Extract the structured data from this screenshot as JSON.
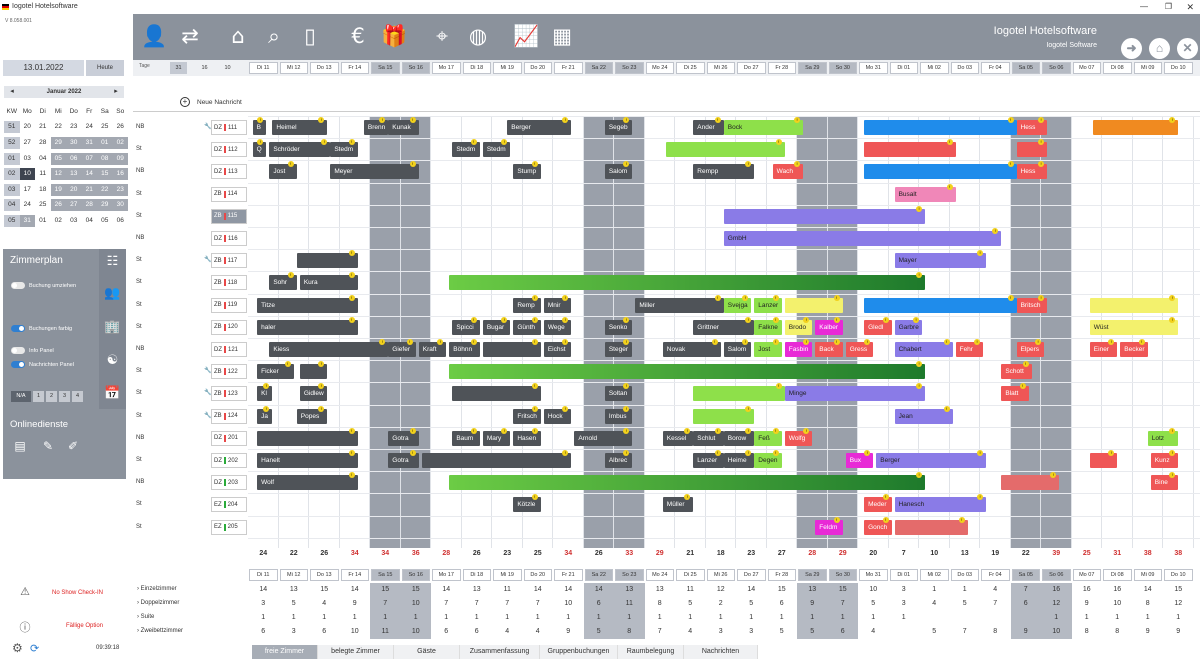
{
  "app": {
    "title": "Iogotel Hotelsoftware",
    "version": "V 8.058.001"
  },
  "calendar": {
    "date": "13.01.2022",
    "today_label": "Heute",
    "month_label": "Januar 2022",
    "prev": "◂",
    "next": "▸",
    "weekdays": [
      "KW",
      "Mo",
      "Di",
      "Mi",
      "Do",
      "Fr",
      "Sa",
      "So"
    ],
    "rows": [
      [
        "51",
        "20",
        "21",
        "22",
        "23",
        "24",
        "25",
        "26"
      ],
      [
        "52",
        "27",
        "28",
        "29",
        "30",
        "31",
        "01",
        "02"
      ],
      [
        "01",
        "03",
        "04",
        "05",
        "06",
        "07",
        "08",
        "09"
      ],
      [
        "02",
        "10",
        "11",
        "12",
        "13",
        "14",
        "15",
        "16"
      ],
      [
        "03",
        "17",
        "18",
        "19",
        "20",
        "21",
        "22",
        "23"
      ],
      [
        "04",
        "24",
        "25",
        "26",
        "27",
        "28",
        "29",
        "30"
      ],
      [
        "05",
        "31",
        "01",
        "02",
        "03",
        "04",
        "05",
        "06"
      ]
    ]
  },
  "sidepanel": {
    "title": "Zimmerplan",
    "toggles": [
      {
        "label": "Buchung umziehen",
        "on": false
      },
      {
        "label": "Buchungen farbig",
        "on": true
      },
      {
        "label": "Info Panel",
        "on": false
      },
      {
        "label": "Nachrichten Panel",
        "on": true
      }
    ],
    "pages": [
      "N/A",
      "1",
      "2",
      "3",
      "4"
    ],
    "online_title": "Onlinedienste"
  },
  "bottom_left": {
    "no_show": "No Show Check-IN",
    "faellige": "Fällige Option",
    "clock": "09:39:18"
  },
  "toolbar": {
    "brand": "Iogotel Hotelsoftware",
    "brand_sub": "Iogotel Software"
  },
  "date_strip": {
    "label": "Tage",
    "options": [
      "31",
      "16",
      "10"
    ]
  },
  "days": [
    "Di 11",
    "Mi 12",
    "Do 13",
    "Fr 14",
    "Sa 15",
    "So 16",
    "Mo 17",
    "Di 18",
    "Mi 19",
    "Do 20",
    "Fr 21",
    "Sa 22",
    "So 23",
    "Mo 24",
    "Di 25",
    "Mi 26",
    "Do 27",
    "Fr 28",
    "Sa 29",
    "So 30",
    "Mo 31",
    "Di 01",
    "Mi 02",
    "Do 03",
    "Fr 04",
    "Sa 05",
    "So 06",
    "Mo 07",
    "Di 08",
    "Mi 09",
    "Do 10"
  ],
  "weekend_idx": [
    4,
    5,
    11,
    12,
    18,
    19,
    25,
    26
  ],
  "new_message": "Neue Nachricht",
  "rooms": [
    {
      "cat": "NB",
      "type": "DZ",
      "no": "111",
      "wrench": true,
      "dot": "r"
    },
    {
      "cat": "St",
      "type": "DZ",
      "no": "112",
      "wrench": false,
      "dot": "r"
    },
    {
      "cat": "NB",
      "type": "DZ",
      "no": "113",
      "wrench": false,
      "dot": "r"
    },
    {
      "cat": "St",
      "type": "ZB",
      "no": "114",
      "wrench": false,
      "dot": "r"
    },
    {
      "cat": "St",
      "type": "ZB",
      "no": "115",
      "wrench": false,
      "dot": "r",
      "sel": true
    },
    {
      "cat": "NB",
      "type": "DZ",
      "no": "116",
      "wrench": false,
      "dot": "r"
    },
    {
      "cat": "St",
      "type": "ZB",
      "no": "117",
      "wrench": true,
      "dot": "r"
    },
    {
      "cat": "St",
      "type": "ZB",
      "no": "118",
      "wrench": false,
      "dot": "r"
    },
    {
      "cat": "St",
      "type": "ZB",
      "no": "119",
      "wrench": false,
      "dot": "r"
    },
    {
      "cat": "St",
      "type": "ZB",
      "no": "120",
      "wrench": false,
      "dot": "r"
    },
    {
      "cat": "NB",
      "type": "DZ",
      "no": "121",
      "wrench": false,
      "dot": "r"
    },
    {
      "cat": "St",
      "type": "ZB",
      "no": "122",
      "wrench": true,
      "dot": "r"
    },
    {
      "cat": "St",
      "type": "ZB",
      "no": "123",
      "wrench": true,
      "dot": "r"
    },
    {
      "cat": "St",
      "type": "ZB",
      "no": "124",
      "wrench": true,
      "dot": "r"
    },
    {
      "cat": "NB",
      "type": "DZ",
      "no": "201",
      "wrench": false,
      "dot": "r"
    },
    {
      "cat": "St",
      "type": "DZ",
      "no": "202",
      "wrench": false,
      "dot": "g"
    },
    {
      "cat": "NB",
      "type": "DZ",
      "no": "203",
      "wrench": false,
      "dot": "g"
    },
    {
      "cat": "St",
      "type": "EZ",
      "no": "204",
      "wrench": false,
      "dot": "g"
    },
    {
      "cat": "St",
      "type": "EZ",
      "no": "205",
      "wrench": false,
      "dot": "g"
    }
  ],
  "bookings": [
    {
      "row": 0,
      "s": 0.15,
      "e": 0.6,
      "c": "dark",
      "t": "B"
    },
    {
      "row": 0,
      "s": 0.8,
      "e": 2.6,
      "c": "dark",
      "t": "Heimel"
    },
    {
      "row": 0,
      "s": 3.8,
      "e": 4.6,
      "c": "dark",
      "t": "Brenn"
    },
    {
      "row": 0,
      "s": 4.6,
      "e": 5.6,
      "c": "dark",
      "t": "Kunak"
    },
    {
      "row": 0,
      "s": 8.5,
      "e": 10.6,
      "c": "dark",
      "t": "Berger"
    },
    {
      "row": 0,
      "s": 11.7,
      "e": 12.6,
      "c": "dark",
      "t": "Segeb"
    },
    {
      "row": 0,
      "s": 14.6,
      "e": 15.6,
      "c": "dark",
      "t": "Ander"
    },
    {
      "row": 0,
      "s": 15.6,
      "e": 18.2,
      "c": "lime",
      "t": "Bock"
    },
    {
      "row": 0,
      "s": 20.2,
      "e": 25.2,
      "c": "blue",
      "t": ""
    },
    {
      "row": 0,
      "s": 25.2,
      "e": 26.2,
      "c": "red",
      "t": "Hess"
    },
    {
      "row": 0,
      "s": 27.7,
      "e": 30.5,
      "c": "orange",
      "t": ""
    },
    {
      "row": 1,
      "s": 0.15,
      "e": 0.6,
      "c": "dark",
      "t": "Q"
    },
    {
      "row": 1,
      "s": 0.7,
      "e": 2.7,
      "c": "dark",
      "t": "Schröder"
    },
    {
      "row": 1,
      "s": 2.7,
      "e": 3.6,
      "c": "dark",
      "t": "Stedm"
    },
    {
      "row": 1,
      "s": 6.7,
      "e": 7.6,
      "c": "dark",
      "t": "Stedm"
    },
    {
      "row": 1,
      "s": 7.7,
      "e": 8.6,
      "c": "dark",
      "t": "Stedm"
    },
    {
      "row": 1,
      "s": 13.7,
      "e": 17.6,
      "c": "lime",
      "t": ""
    },
    {
      "row": 1,
      "s": 20.2,
      "e": 23.2,
      "c": "red",
      "t": ""
    },
    {
      "row": 1,
      "s": 25.2,
      "e": 26.2,
      "c": "red",
      "t": ""
    },
    {
      "row": 2,
      "s": 0.7,
      "e": 1.6,
      "c": "dark",
      "t": "Jost"
    },
    {
      "row": 2,
      "s": 2.7,
      "e": 5.6,
      "c": "dark",
      "t": "Meyer"
    },
    {
      "row": 2,
      "s": 8.7,
      "e": 9.6,
      "c": "dark",
      "t": "Stump"
    },
    {
      "row": 2,
      "s": 11.7,
      "e": 12.6,
      "c": "dark",
      "t": "Salom"
    },
    {
      "row": 2,
      "s": 14.6,
      "e": 16.6,
      "c": "dark",
      "t": "Rempp"
    },
    {
      "row": 2,
      "s": 17.2,
      "e": 18.2,
      "c": "red",
      "t": "Wach"
    },
    {
      "row": 2,
      "s": 20.2,
      "e": 25.2,
      "c": "blue",
      "t": ""
    },
    {
      "row": 2,
      "s": 25.2,
      "e": 26.2,
      "c": "red",
      "t": "Hess"
    },
    {
      "row": 3,
      "s": 21.2,
      "e": 23.2,
      "c": "pink",
      "t": "Busalt"
    },
    {
      "row": 4,
      "s": 15.6,
      "e": 22.2,
      "c": "purple",
      "t": ""
    },
    {
      "row": 5,
      "s": 15.6,
      "e": 24.7,
      "c": "purple",
      "t": "GmbH"
    },
    {
      "row": 6,
      "s": 1.6,
      "e": 3.6,
      "c": "dark",
      "t": ""
    },
    {
      "row": 6,
      "s": 21.2,
      "e": 24.2,
      "c": "purple",
      "t": "Mayer"
    },
    {
      "row": 7,
      "s": 0.7,
      "e": 1.6,
      "c": "dark",
      "t": "Sohr"
    },
    {
      "row": 7,
      "s": 1.7,
      "e": 3.6,
      "c": "dark",
      "t": "Kura"
    },
    {
      "row": 7,
      "s": 6.6,
      "e": 22.2,
      "c": "green",
      "t": ""
    },
    {
      "row": 8,
      "s": 0.3,
      "e": 3.6,
      "c": "dark",
      "t": "Titze"
    },
    {
      "row": 8,
      "s": 8.7,
      "e": 9.6,
      "c": "dark",
      "t": "Remp"
    },
    {
      "row": 8,
      "s": 9.7,
      "e": 10.6,
      "c": "dark",
      "t": "Mnir"
    },
    {
      "row": 8,
      "s": 12.7,
      "e": 15.6,
      "c": "dark",
      "t": "Miller"
    },
    {
      "row": 8,
      "s": 15.6,
      "e": 16.5,
      "c": "lime",
      "t": "Svejga"
    },
    {
      "row": 8,
      "s": 16.6,
      "e": 17.5,
      "c": "lime",
      "t": "Lanzer"
    },
    {
      "row": 8,
      "s": 17.6,
      "e": 19.5,
      "c": "yellow",
      "t": ""
    },
    {
      "row": 8,
      "s": 20.2,
      "e": 25.2,
      "c": "blue",
      "t": ""
    },
    {
      "row": 8,
      "s": 25.2,
      "e": 26.2,
      "c": "red",
      "t": "Britsch"
    },
    {
      "row": 8,
      "s": 27.6,
      "e": 30.5,
      "c": "yellow",
      "t": ""
    },
    {
      "row": 9,
      "s": 0.3,
      "e": 3.6,
      "c": "dark",
      "t": "haler"
    },
    {
      "row": 9,
      "s": 6.7,
      "e": 7.6,
      "c": "dark",
      "t": "Spicci"
    },
    {
      "row": 9,
      "s": 7.7,
      "e": 8.6,
      "c": "dark",
      "t": "Bugar"
    },
    {
      "row": 9,
      "s": 8.7,
      "e": 9.6,
      "c": "dark",
      "t": "Günth"
    },
    {
      "row": 9,
      "s": 9.7,
      "e": 10.6,
      "c": "dark",
      "t": "Wege"
    },
    {
      "row": 9,
      "s": 11.7,
      "e": 12.6,
      "c": "dark",
      "t": "Senko"
    },
    {
      "row": 9,
      "s": 14.6,
      "e": 16.6,
      "c": "dark",
      "t": "Grittner"
    },
    {
      "row": 9,
      "s": 16.6,
      "e": 17.5,
      "c": "lime",
      "t": "Falkne"
    },
    {
      "row": 9,
      "s": 17.6,
      "e": 18.5,
      "c": "yellow",
      "t": "Brodo"
    },
    {
      "row": 9,
      "s": 18.6,
      "e": 19.5,
      "c": "magenta",
      "t": "Kalber"
    },
    {
      "row": 9,
      "s": 20.2,
      "e": 21.1,
      "c": "red",
      "t": "Gledl"
    },
    {
      "row": 9,
      "s": 21.2,
      "e": 22.1,
      "c": "purple",
      "t": "Garbre"
    },
    {
      "row": 9,
      "s": 27.6,
      "e": 30.5,
      "c": "yellow",
      "t": "Wüst"
    },
    {
      "row": 10,
      "s": 0.7,
      "e": 4.6,
      "c": "dark",
      "t": "Kiess"
    },
    {
      "row": 10,
      "s": 4.6,
      "e": 5.5,
      "c": "dark",
      "t": "Giefer"
    },
    {
      "row": 10,
      "s": 5.6,
      "e": 6.5,
      "c": "dark",
      "t": "Kraft"
    },
    {
      "row": 10,
      "s": 6.6,
      "e": 7.6,
      "c": "dark",
      "t": "Böhnn"
    },
    {
      "row": 10,
      "s": 7.7,
      "e": 9.6,
      "c": "dark",
      "t": ""
    },
    {
      "row": 10,
      "s": 9.7,
      "e": 10.6,
      "c": "dark",
      "t": "Eichst"
    },
    {
      "row": 10,
      "s": 11.7,
      "e": 12.6,
      "c": "dark",
      "t": "Steger"
    },
    {
      "row": 10,
      "s": 13.6,
      "e": 15.5,
      "c": "dark",
      "t": "Novak"
    },
    {
      "row": 10,
      "s": 15.6,
      "e": 16.5,
      "c": "dark",
      "t": "Salom"
    },
    {
      "row": 10,
      "s": 16.6,
      "e": 17.5,
      "c": "lime",
      "t": "Jost"
    },
    {
      "row": 10,
      "s": 17.6,
      "e": 18.5,
      "c": "magenta",
      "t": "Fasbin"
    },
    {
      "row": 10,
      "s": 18.6,
      "e": 19.5,
      "c": "red",
      "t": "Back"
    },
    {
      "row": 10,
      "s": 19.6,
      "e": 20.5,
      "c": "red",
      "t": "Gress"
    },
    {
      "row": 10,
      "s": 21.2,
      "e": 23.1,
      "c": "purple",
      "t": "Chabert"
    },
    {
      "row": 10,
      "s": 23.2,
      "e": 24.1,
      "c": "red",
      "t": "Fehr"
    },
    {
      "row": 10,
      "s": 25.2,
      "e": 26.1,
      "c": "red",
      "t": "Elpers"
    },
    {
      "row": 10,
      "s": 27.6,
      "e": 28.5,
      "c": "red",
      "t": "Einer"
    },
    {
      "row": 10,
      "s": 28.6,
      "e": 29.5,
      "c": "red",
      "t": "Becker"
    },
    {
      "row": 11,
      "s": 0.3,
      "e": 1.5,
      "c": "dark",
      "t": "Ficker"
    },
    {
      "row": 11,
      "s": 1.7,
      "e": 2.6,
      "c": "dark",
      "t": ""
    },
    {
      "row": 11,
      "s": 6.6,
      "e": 22.2,
      "c": "green",
      "t": ""
    },
    {
      "row": 11,
      "s": 24.7,
      "e": 25.7,
      "c": "red",
      "t": "Schott"
    },
    {
      "row": 12,
      "s": 0.3,
      "e": 0.8,
      "c": "dark",
      "t": "Kl"
    },
    {
      "row": 12,
      "s": 1.7,
      "e": 2.6,
      "c": "dark",
      "t": "Gidlew"
    },
    {
      "row": 12,
      "s": 6.7,
      "e": 9.6,
      "c": "dark",
      "t": ""
    },
    {
      "row": 12,
      "s": 11.7,
      "e": 12.6,
      "c": "dark",
      "t": "Soltan"
    },
    {
      "row": 12,
      "s": 14.6,
      "e": 17.6,
      "c": "lime",
      "t": ""
    },
    {
      "row": 12,
      "s": 17.6,
      "e": 22.2,
      "c": "purple",
      "t": "Minge"
    },
    {
      "row": 12,
      "s": 24.7,
      "e": 25.6,
      "c": "red",
      "t": "Blatt"
    },
    {
      "row": 13,
      "s": 0.3,
      "e": 0.8,
      "c": "dark",
      "t": "Ja"
    },
    {
      "row": 13,
      "s": 1.6,
      "e": 2.6,
      "c": "dark",
      "t": "Popes"
    },
    {
      "row": 13,
      "s": 8.7,
      "e": 9.6,
      "c": "dark",
      "t": "Fritsch"
    },
    {
      "row": 13,
      "s": 9.7,
      "e": 10.6,
      "c": "dark",
      "t": "Hock"
    },
    {
      "row": 13,
      "s": 11.7,
      "e": 12.6,
      "c": "dark",
      "t": "Imbus"
    },
    {
      "row": 13,
      "s": 14.6,
      "e": 16.6,
      "c": "lime",
      "t": ""
    },
    {
      "row": 13,
      "s": 21.2,
      "e": 23.1,
      "c": "purple",
      "t": "Jean"
    },
    {
      "row": 14,
      "s": 0.3,
      "e": 3.6,
      "c": "dark",
      "t": ""
    },
    {
      "row": 14,
      "s": 4.6,
      "e": 5.6,
      "c": "dark",
      "t": "Gotra"
    },
    {
      "row": 14,
      "s": 6.7,
      "e": 7.6,
      "c": "dark",
      "t": "Baum"
    },
    {
      "row": 14,
      "s": 7.7,
      "e": 8.6,
      "c": "dark",
      "t": "Mary"
    },
    {
      "row": 14,
      "s": 8.7,
      "e": 9.6,
      "c": "dark",
      "t": "Hasen"
    },
    {
      "row": 14,
      "s": 10.7,
      "e": 12.6,
      "c": "dark",
      "t": "Arnold"
    },
    {
      "row": 14,
      "s": 13.6,
      "e": 14.6,
      "c": "dark",
      "t": "Kessel"
    },
    {
      "row": 14,
      "s": 14.6,
      "e": 15.6,
      "c": "dark",
      "t": "Schlut"
    },
    {
      "row": 14,
      "s": 15.6,
      "e": 16.6,
      "c": "dark",
      "t": "Borow"
    },
    {
      "row": 14,
      "s": 16.6,
      "e": 17.5,
      "c": "lime",
      "t": "Feß"
    },
    {
      "row": 14,
      "s": 17.6,
      "e": 18.5,
      "c": "red",
      "t": "Wolfg"
    },
    {
      "row": 14,
      "s": 29.5,
      "e": 30.5,
      "c": "lime",
      "t": "Lotz"
    },
    {
      "row": 15,
      "s": 0.3,
      "e": 3.6,
      "c": "dark",
      "t": "Hanelt"
    },
    {
      "row": 15,
      "s": 4.6,
      "e": 5.6,
      "c": "dark",
      "t": "Gotra"
    },
    {
      "row": 15,
      "s": 5.7,
      "e": 10.6,
      "c": "dark",
      "t": ""
    },
    {
      "row": 15,
      "s": 11.7,
      "e": 12.6,
      "c": "dark",
      "t": "Albrec"
    },
    {
      "row": 15,
      "s": 14.6,
      "e": 15.6,
      "c": "dark",
      "t": "Lanzer"
    },
    {
      "row": 15,
      "s": 15.6,
      "e": 16.6,
      "c": "dark",
      "t": "Heime"
    },
    {
      "row": 15,
      "s": 16.6,
      "e": 17.5,
      "c": "lime",
      "t": "Degen"
    },
    {
      "row": 15,
      "s": 19.6,
      "e": 20.5,
      "c": "magenta",
      "t": "Bux"
    },
    {
      "row": 15,
      "s": 20.6,
      "e": 24.2,
      "c": "purple",
      "t": "Berger"
    },
    {
      "row": 15,
      "s": 27.6,
      "e": 28.5,
      "c": "red",
      "t": ""
    },
    {
      "row": 15,
      "s": 29.6,
      "e": 30.5,
      "c": "red",
      "t": "Kunz"
    },
    {
      "row": 16,
      "s": 0.3,
      "e": 3.6,
      "c": "dark",
      "t": "Wolf"
    },
    {
      "row": 16,
      "s": 6.6,
      "e": 22.2,
      "c": "green",
      "t": ""
    },
    {
      "row": 16,
      "s": 24.7,
      "e": 26.6,
      "c": "salmon",
      "t": ""
    },
    {
      "row": 16,
      "s": 29.6,
      "e": 30.5,
      "c": "red",
      "t": "Bine"
    },
    {
      "row": 17,
      "s": 8.7,
      "e": 9.6,
      "c": "dark",
      "t": "Kötzle"
    },
    {
      "row": 17,
      "s": 13.6,
      "e": 14.6,
      "c": "dark",
      "t": "Müller"
    },
    {
      "row": 17,
      "s": 20.2,
      "e": 21.1,
      "c": "red",
      "t": "Meder"
    },
    {
      "row": 17,
      "s": 21.2,
      "e": 24.2,
      "c": "purple",
      "t": "Hanesch"
    },
    {
      "row": 18,
      "s": 18.6,
      "e": 19.5,
      "c": "magenta",
      "t": "Feldm"
    },
    {
      "row": 18,
      "s": 20.2,
      "e": 21.1,
      "c": "red",
      "t": "Gonch"
    },
    {
      "row": 18,
      "s": 21.2,
      "e": 23.6,
      "c": "salmon",
      "t": ""
    }
  ],
  "totals": [
    "24",
    "22",
    "26",
    "34",
    "34",
    "36",
    "28",
    "26",
    "23",
    "25",
    "34",
    "26",
    "33",
    "29",
    "21",
    "18",
    "23",
    "27",
    "28",
    "29",
    "20",
    "7",
    "10",
    "13",
    "19",
    "22",
    "39",
    "25",
    "31",
    "38",
    "38"
  ],
  "stats": {
    "labels": [
      "Einzelzimmer",
      "Doppelzimmer",
      "Suite",
      "Zweibettzimmer"
    ],
    "rows": [
      [
        "14",
        "13",
        "15",
        "14",
        "15",
        "15",
        "14",
        "13",
        "11",
        "14",
        "14",
        "14",
        "13",
        "13",
        "11",
        "12",
        "14",
        "15",
        "13",
        "15",
        "10",
        "3",
        "1",
        "1",
        "4",
        "7",
        "16",
        "16",
        "16",
        "14",
        "15"
      ],
      [
        "3",
        "5",
        "4",
        "9",
        "7",
        "10",
        "7",
        "7",
        "7",
        "7",
        "10",
        "6",
        "11",
        "8",
        "5",
        "2",
        "5",
        "6",
        "9",
        "7",
        "5",
        "3",
        "4",
        "5",
        "7",
        "6",
        "12",
        "9",
        "10",
        "8",
        "12"
      ],
      [
        "1",
        "1",
        "1",
        "1",
        "1",
        "1",
        "1",
        "1",
        "1",
        "1",
        "1",
        "1",
        "1",
        "1",
        "1",
        "1",
        "1",
        "1",
        "1",
        "1",
        "1",
        "1",
        "",
        "",
        "",
        "",
        "1",
        "1",
        "1",
        "1",
        "1"
      ],
      [
        "6",
        "3",
        "6",
        "10",
        "11",
        "10",
        "6",
        "6",
        "4",
        "4",
        "9",
        "5",
        "8",
        "7",
        "4",
        "3",
        "3",
        "5",
        "5",
        "6",
        "4",
        "",
        "5",
        "7",
        "8",
        "9",
        "10",
        "8",
        "8",
        "9",
        "9"
      ]
    ]
  },
  "tabs": [
    "freie Zimmer",
    "belegte Zimmer",
    "Gäste",
    "Zusammenfassung",
    "Gruppenbuchungen",
    "Raumbelegung",
    "Nachrichten"
  ]
}
